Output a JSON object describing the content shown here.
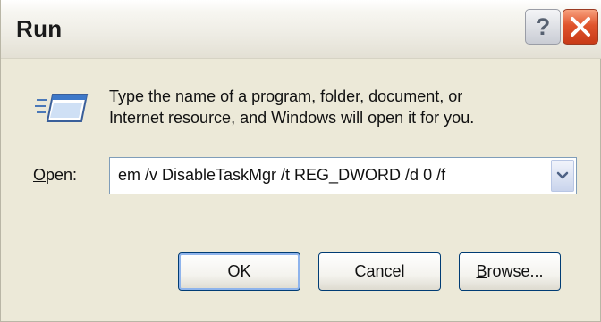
{
  "window": {
    "title": "Run",
    "help_label": "?",
    "close_label": "X"
  },
  "prompt": {
    "line1": "Type the name of a program, folder, document, or",
    "line2": "Internet resource, and Windows will open it for you."
  },
  "open": {
    "label_first": "O",
    "label_rest": "pen:",
    "value": "em /v DisableTaskMgr /t REG_DWORD /d 0 /f"
  },
  "buttons": {
    "ok": "OK",
    "cancel": "Cancel",
    "browse_first": "B",
    "browse_rest": "rowse..."
  },
  "icons": {
    "run": "run-program-icon",
    "dropdown": "chevron-down-icon"
  }
}
